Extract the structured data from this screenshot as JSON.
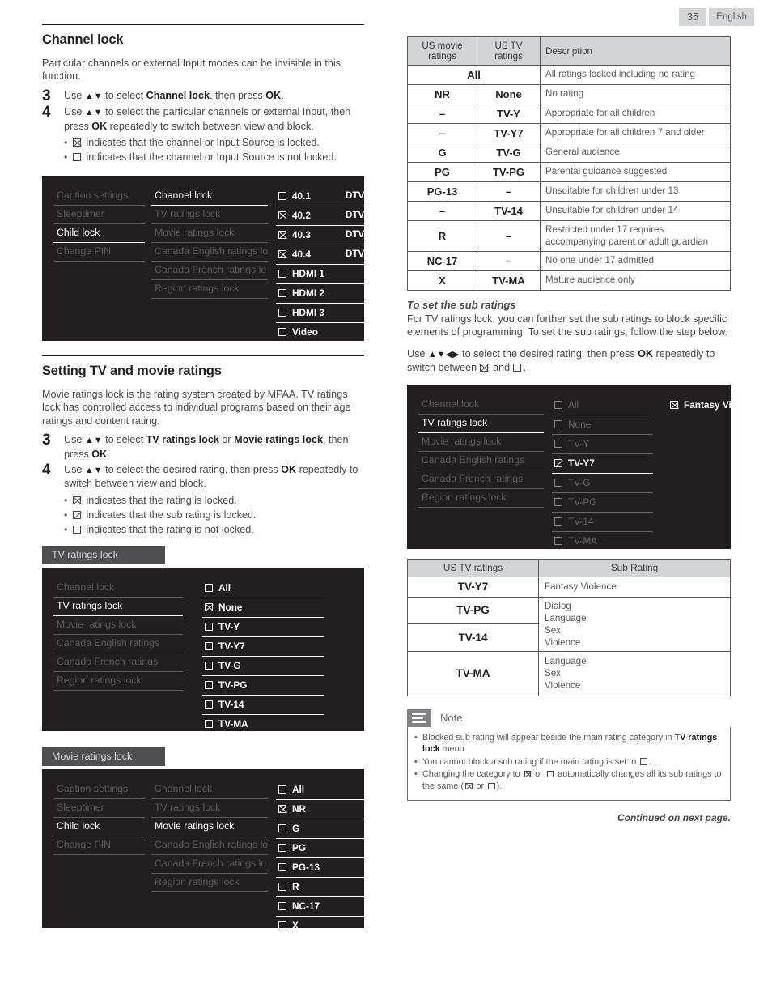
{
  "header": {
    "page_number": "35",
    "language": "English"
  },
  "left": {
    "section1": {
      "title": "Channel lock",
      "intro": "Particular channels or external Input modes can be invisible in this function.",
      "steps": [
        {
          "num": "3",
          "html": "Use <span class=\"arr\">▲▼</span> to select <span class=\"b\">Channel lock</span>, then press <span class=\"b\">OK</span>."
        },
        {
          "num": "4",
          "html": "Use <span class=\"arr\">▲▼</span> to select the particular channels or external Input, then press <span class=\"b\">OK</span> repeatedly to switch between view and block."
        }
      ],
      "bullets": [
        {
          "box": "x",
          "text": "indicates that the channel or Input Source is locked."
        },
        {
          "box": "open",
          "text": "indicates that the channel or Input Source is not locked."
        }
      ]
    },
    "osd_channel_lock": {
      "col1": [
        {
          "label": "Caption settings",
          "state": "dim"
        },
        {
          "label": "Sleeptimer",
          "state": "dim"
        },
        {
          "label": "Child lock",
          "state": "act"
        },
        {
          "label": "Change PIN",
          "state": "dim"
        }
      ],
      "col2": [
        {
          "label": "Channel lock",
          "state": "act"
        },
        {
          "label": "TV ratings lock",
          "state": "dim"
        },
        {
          "label": "Movie ratings lock",
          "state": "dim"
        },
        {
          "label": "Canada English ratings lo",
          "state": "dim"
        },
        {
          "label": "Canada French ratings lo",
          "state": "dim"
        },
        {
          "label": "Region ratings lock",
          "state": "dim"
        }
      ],
      "col3": [
        {
          "label": "40.1",
          "box": "open",
          "suffix": "DTV"
        },
        {
          "label": "40.2",
          "box": "x",
          "suffix": "DTV"
        },
        {
          "label": "40.3",
          "box": "x",
          "suffix": "DTV"
        },
        {
          "label": "40.4",
          "box": "x",
          "suffix": "DTV"
        },
        {
          "label": "HDMI 1",
          "box": "open",
          "suffix": ""
        },
        {
          "label": "HDMI 2",
          "box": "open",
          "suffix": ""
        },
        {
          "label": "HDMI 3",
          "box": "open",
          "suffix": ""
        },
        {
          "label": "Video",
          "box": "open",
          "suffix": ""
        }
      ]
    },
    "section2": {
      "title": "Setting TV and movie ratings",
      "intro": "Movie ratings lock is the rating system created by MPAA. TV ratings lock has controlled access to individual programs based on their age ratings and content rating.",
      "steps": [
        {
          "num": "3",
          "html": "Use <span class=\"arr\">▲▼</span> to select <span class=\"b\">TV ratings lock</span> or <span class=\"b\">Movie ratings lock</span>, then press <span class=\"b\">OK</span>."
        },
        {
          "num": "4",
          "html": "Use <span class=\"arr\">▲▼</span> to select the desired rating, then press <span class=\"b\">OK</span> repeatedly to switch between view and block."
        }
      ],
      "bullets": [
        {
          "box": "x",
          "text": "indicates that the rating is locked."
        },
        {
          "box": "half",
          "text": "indicates that the sub rating is locked."
        },
        {
          "box": "open",
          "text": "indicates that the rating is not locked."
        }
      ]
    },
    "caption_tv_ratings": "TV ratings lock",
    "osd_tv_ratings": {
      "col1": [
        {
          "label": "Channel lock",
          "state": "dim"
        },
        {
          "label": "TV ratings lock",
          "state": "act"
        },
        {
          "label": "Movie ratings lock",
          "state": "dim"
        },
        {
          "label": "Canada English ratings",
          "state": "dim"
        },
        {
          "label": "Canada French ratings",
          "state": "dim"
        },
        {
          "label": "Region ratings lock",
          "state": "dim"
        }
      ],
      "col2": [
        {
          "label": "All",
          "box": "open"
        },
        {
          "label": "None",
          "box": "x"
        },
        {
          "label": "TV-Y",
          "box": "open"
        },
        {
          "label": "TV-Y7",
          "box": "open"
        },
        {
          "label": "TV-G",
          "box": "open"
        },
        {
          "label": "TV-PG",
          "box": "open"
        },
        {
          "label": "TV-14",
          "box": "open"
        },
        {
          "label": "TV-MA",
          "box": "open"
        }
      ]
    },
    "caption_movie_ratings": "Movie ratings lock",
    "osd_movie_ratings": {
      "col1": [
        {
          "label": "Caption settings",
          "state": "dim"
        },
        {
          "label": "Sleeptimer",
          "state": "dim"
        },
        {
          "label": "Child lock",
          "state": "act"
        },
        {
          "label": "Change PIN",
          "state": "dim"
        }
      ],
      "col2": [
        {
          "label": "Channel lock",
          "state": "dim"
        },
        {
          "label": "TV ratings lock",
          "state": "dim"
        },
        {
          "label": "Movie ratings lock",
          "state": "act"
        },
        {
          "label": "Canada English ratings lo",
          "state": "dim"
        },
        {
          "label": "Canada French ratings lo",
          "state": "dim"
        },
        {
          "label": "Region ratings lock",
          "state": "dim"
        }
      ],
      "col3": [
        {
          "label": "All",
          "box": "open"
        },
        {
          "label": "NR",
          "box": "x"
        },
        {
          "label": "G",
          "box": "open"
        },
        {
          "label": "PG",
          "box": "open"
        },
        {
          "label": "PG-13",
          "box": "open"
        },
        {
          "label": "R",
          "box": "open"
        },
        {
          "label": "NC-17",
          "box": "open"
        },
        {
          "label": "X",
          "box": "open"
        }
      ]
    }
  },
  "right": {
    "ratings_table": {
      "headers": [
        "US movie ratings",
        "US TV ratings",
        "Description"
      ],
      "rows": [
        {
          "movie": "All",
          "tv": "",
          "desc": "All ratings locked including no rating",
          "span": true
        },
        {
          "movie": "NR",
          "tv": "None",
          "desc": "No rating"
        },
        {
          "movie": "–",
          "tv": "TV-Y",
          "desc": "Appropriate for all children"
        },
        {
          "movie": "–",
          "tv": "TV-Y7",
          "desc": "Appropriate for all children 7 and older"
        },
        {
          "movie": "G",
          "tv": "TV-G",
          "desc": "General audience"
        },
        {
          "movie": "PG",
          "tv": "TV-PG",
          "desc": "Parental guidance suggested"
        },
        {
          "movie": "PG-13",
          "tv": "–",
          "desc": "Unsuitable for children under 13"
        },
        {
          "movie": "–",
          "tv": "TV-14",
          "desc": "Unsuitable for children under 14"
        },
        {
          "movie": "R",
          "tv": "–",
          "desc": "Restricted under 17 requires accompanying parent or adult guardian"
        },
        {
          "movie": "NC-17",
          "tv": "–",
          "desc": "No one under 17 admitted"
        },
        {
          "movie": "X",
          "tv": "TV-MA",
          "desc": "Mature audience only"
        }
      ]
    },
    "subratings_heading": "To set the sub ratings",
    "subratings_intro": "For TV ratings lock, you can further set the sub ratings to block specific elements of programming. To set the sub ratings, follow the step below.",
    "subratings_step_html": "Use <span class=\"arr\">▲▼◀▶</span> to select the desired rating, then press <span class=\"b\">OK</span> repeatedly to switch between <span class=\"cbx x\"></span> and <span class=\"cbx\"></span>.",
    "osd_subratings": {
      "col1": [
        {
          "label": "Channel lock",
          "state": "dim"
        },
        {
          "label": "TV ratings lock",
          "state": "act"
        },
        {
          "label": "Movie ratings lock",
          "state": "dim"
        },
        {
          "label": "Canada English ratings",
          "state": "dim"
        },
        {
          "label": "Canada French ratings",
          "state": "dim"
        },
        {
          "label": "Region ratings lock",
          "state": "dim"
        }
      ],
      "col2": [
        {
          "label": "All",
          "box": "open",
          "state": "dim"
        },
        {
          "label": "None",
          "box": "open",
          "state": "dim"
        },
        {
          "label": "TV-Y",
          "box": "open",
          "state": "dim"
        },
        {
          "label": "TV-Y7",
          "box": "half",
          "state": "act"
        },
        {
          "label": "TV-G",
          "box": "open",
          "state": "dim"
        },
        {
          "label": "TV-PG",
          "box": "open",
          "state": "dim"
        },
        {
          "label": "TV-14",
          "box": "open",
          "state": "dim"
        },
        {
          "label": "TV-MA",
          "box": "open",
          "state": "dim"
        }
      ],
      "col3": [
        {
          "label": "Fantasy Violence",
          "box": "x",
          "state": "act"
        }
      ]
    },
    "sub_table": {
      "headers": [
        "US TV ratings",
        "Sub Rating"
      ],
      "rows": [
        {
          "rating": "TV-Y7",
          "subs": [
            "Fantasy Violence"
          ]
        },
        {
          "rating": "TV-PG",
          "subs": [
            "Dialog",
            "Language"
          ],
          "merged_group": 1
        },
        {
          "rating": "TV-14",
          "subs": [
            "Sex",
            "Violence"
          ],
          "merged_group": 1
        },
        {
          "rating": "TV-MA",
          "subs": [
            "Language",
            "Sex",
            "Violence"
          ]
        }
      ]
    },
    "note": {
      "label": "Note",
      "items": [
        {
          "html": "Blocked sub rating will appear beside the main rating category in <span class=\"b\">TV ratings lock</span> menu."
        },
        {
          "html": "You cannot block a sub rating if the main rating is set to <span class=\"cbx\"></span>."
        },
        {
          "html": "Changing the category to <span class=\"cbx x\"></span> or <span class=\"cbx\"></span> automatically changes all its sub ratings to the same (<span class=\"cbx x\"></span> or <span class=\"cbx\"></span>)."
        }
      ]
    },
    "continued": "Continued on next page."
  }
}
